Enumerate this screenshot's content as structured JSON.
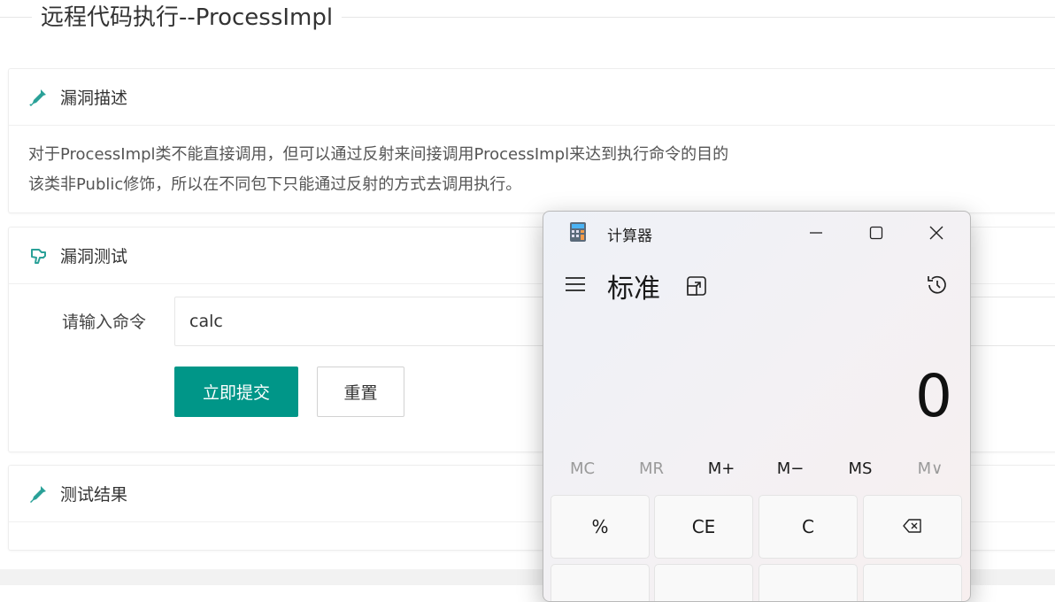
{
  "page": {
    "title": "远程代码执行--ProcessImpl"
  },
  "sections": {
    "description": {
      "header": "漏洞描述",
      "lines": [
        "对于ProcessImpl类不能直接调用，但可以通过反射来间接调用ProcessImpl来达到执行命令的目的",
        "该类非Public修饰，所以在不同包下只能通过反射的方式去调用执行。"
      ]
    },
    "test": {
      "header": "漏洞测试",
      "command_label": "请输入命令",
      "command_value": "calc",
      "submit_label": "立即提交",
      "reset_label": "重置"
    },
    "result": {
      "header": "测试结果"
    }
  },
  "calculator": {
    "window_title": "计算器",
    "mode": "标准",
    "display_value": "0",
    "memory_buttons": [
      {
        "label": "MC",
        "enabled": false
      },
      {
        "label": "MR",
        "enabled": false
      },
      {
        "label": "M+",
        "enabled": true
      },
      {
        "label": "M−",
        "enabled": true
      },
      {
        "label": "MS",
        "enabled": true
      },
      {
        "label": "M∨",
        "enabled": false
      }
    ],
    "keys_row1": [
      "%",
      "CE",
      "C",
      "⌫"
    ]
  },
  "colors": {
    "primary": "#009688",
    "icon_teal": "#2aa198"
  },
  "icons": {
    "section_description": "pipette-icon",
    "section_test": "hand-pointer-icon",
    "section_result": "pipette-icon"
  }
}
